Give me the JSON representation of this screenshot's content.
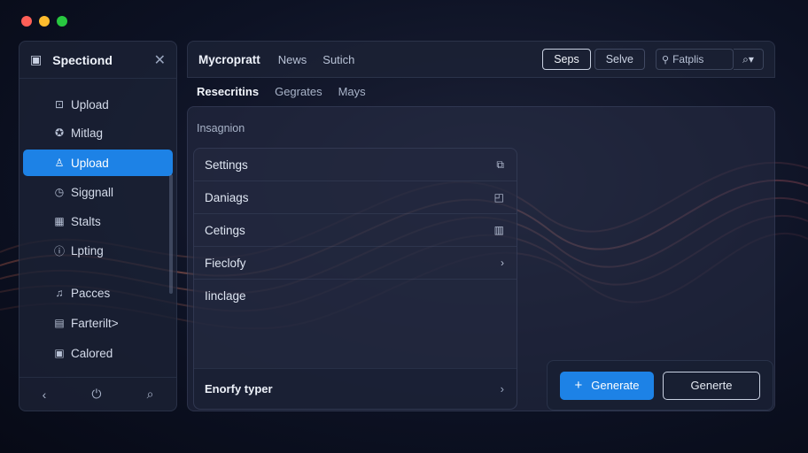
{
  "window": {
    "traffic_colors": [
      "#ff5f57",
      "#febc2e",
      "#28c840"
    ]
  },
  "sidebar": {
    "title": "Spectiond",
    "header_icon": "panel-icon",
    "items": [
      {
        "label": "Upload",
        "icon": "upload-icon",
        "active": false
      },
      {
        "label": "Mitlag",
        "icon": "badge-icon",
        "active": false
      },
      {
        "label": "Upload",
        "icon": "user-icon",
        "active": true
      },
      {
        "label": "Siggnall",
        "icon": "clock-icon",
        "active": false
      },
      {
        "label": "Stalts",
        "icon": "chart-icon",
        "active": false
      },
      {
        "label": "Lpting",
        "icon": "info-icon",
        "active": false
      },
      {
        "label": "Pacces",
        "icon": "music-icon",
        "active": false
      },
      {
        "label": "Farterilt>",
        "icon": "grid-icon",
        "active": false
      },
      {
        "label": "Calored",
        "icon": "palette-icon",
        "active": false
      }
    ]
  },
  "topbar": {
    "brand": "Mycropratt",
    "nav": [
      "News",
      "Sutich"
    ],
    "btn_primary": "Seps",
    "btn_secondary": "Selve",
    "search_placeholder": "Fatplis"
  },
  "tabs": [
    {
      "label": "Resecritins",
      "active": true
    },
    {
      "label": "Gegrates",
      "active": false
    },
    {
      "label": "Mays",
      "active": false
    }
  ],
  "main": {
    "section_label": "Insagnion",
    "list": [
      {
        "label": "Settings",
        "icon": "expand-icon"
      },
      {
        "label": "Daniags",
        "icon": "square-icon"
      },
      {
        "label": "Cetings",
        "icon": "doc-icon"
      },
      {
        "label": "Fieclofy",
        "icon": "chevron-right-icon"
      },
      {
        "label": "Iinclage",
        "icon": ""
      }
    ],
    "footer_label": "Enorfy typer"
  },
  "actions": {
    "generate": "Generate",
    "generte": "Generte"
  },
  "colors": {
    "accent": "#1d82e6"
  }
}
